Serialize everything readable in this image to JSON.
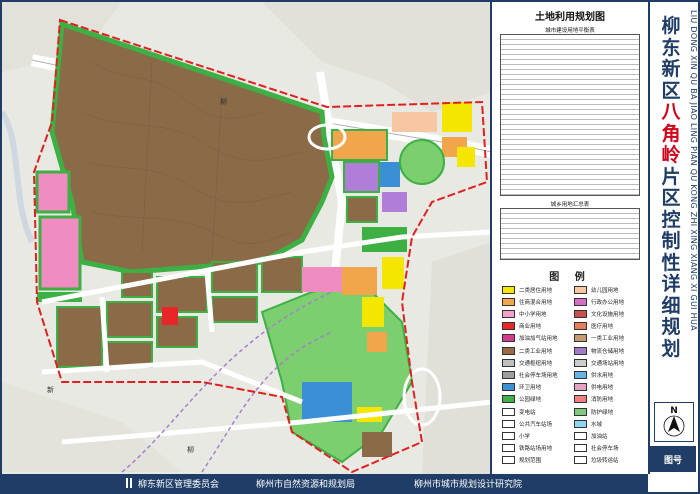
{
  "title": {
    "chars": [
      "柳",
      "东",
      "新",
      "区",
      "八",
      "角",
      "岭",
      "片",
      "区",
      "控",
      "制",
      "性",
      "详",
      "细",
      "规",
      "划"
    ],
    "highlight_chars": [
      "八",
      "角",
      "岭"
    ],
    "pinyin": "LIU DONG XIN QU BA JIAO LING PIAN QU KONG ZHI XING XIANG XI GUI HUA"
  },
  "legend_panel": {
    "heading": "土地利用规划图",
    "table1_title": "城市建设用地平衡表",
    "table2_title": "城乡用地汇总表",
    "legend_title": "图 例",
    "items_left": [
      {
        "label": "二类居住用地",
        "color": "#f5e600"
      },
      {
        "label": "住商混合用地",
        "color": "#f2a64b"
      },
      {
        "label": "中小学用地",
        "color": "#f4a0c8"
      },
      {
        "label": "商业用地",
        "color": "#e8262a"
      },
      {
        "label": "加油加气站用地",
        "color": "#d63b8b"
      },
      {
        "label": "二类工业用地",
        "color": "#9b6a45"
      },
      {
        "label": "交通枢纽用地",
        "color": "#bfbfbf"
      },
      {
        "label": "社会停车场用地",
        "color": "#9e9e9e"
      },
      {
        "label": "环卫用地",
        "color": "#3b8fd4"
      },
      {
        "label": "公园绿地",
        "color": "#42b048"
      },
      {
        "label": "变电站",
        "color": "#ffffff"
      },
      {
        "label": "公共汽车站场",
        "color": "#ffffff"
      },
      {
        "label": "小学",
        "color": "#ffffff"
      },
      {
        "label": "铁路站场用地",
        "color": "#ffffff"
      },
      {
        "label": "规划范围",
        "color": "#ffffff"
      }
    ],
    "items_right": [
      {
        "label": "幼儿园用地",
        "color": "#f7c6a3"
      },
      {
        "label": "行政办公用地",
        "color": "#d46ec7"
      },
      {
        "label": "文化设施用地",
        "color": "#c94f4f"
      },
      {
        "label": "医疗用地",
        "color": "#e57f5a"
      },
      {
        "label": "一类工业用地",
        "color": "#c79a72"
      },
      {
        "label": "物流仓储用地",
        "color": "#a17bc9"
      },
      {
        "label": "交通场站用地",
        "color": "#cccccc"
      },
      {
        "label": "供水用地",
        "color": "#66b3e6"
      },
      {
        "label": "供电用地",
        "color": "#e6a0c0"
      },
      {
        "label": "消防用地",
        "color": "#f07f7f"
      },
      {
        "label": "防护绿地",
        "color": "#7fc97f"
      },
      {
        "label": "水域",
        "color": "#8fd3f0"
      },
      {
        "label": "加油站",
        "color": "#ffffff"
      },
      {
        "label": "社会停车场",
        "color": "#ffffff"
      },
      {
        "label": "垃圾转运站",
        "color": "#ffffff"
      }
    ]
  },
  "map": {
    "road_labels": [
      "柳",
      "柳",
      "新"
    ]
  },
  "north": {
    "label": "N"
  },
  "sheet_label": "图号",
  "bottom_bar": {
    "org1": "柳东新区管理委员会",
    "org2": "柳州市自然资源和规划局",
    "org3": "柳州市城市规划设计研究院"
  },
  "colors": {
    "frame": "#1f3d66",
    "industrial": "#8b6a48",
    "green": "#3cb043",
    "road": "#ffffff",
    "boundary": "#e02020",
    "title_red": "#d0021b"
  }
}
